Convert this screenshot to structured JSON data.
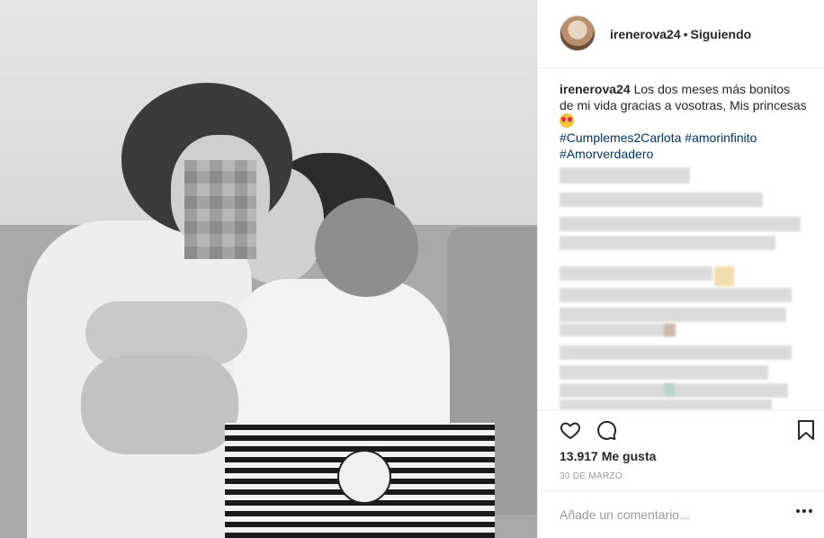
{
  "post": {
    "image_alt": "",
    "username": "irenerova24",
    "separator": "•",
    "follow_status": "Siguiendo",
    "caption_text": "Los dos meses más bonitos de mi vida gracias a vosotras, Mis princesas",
    "caption_emoji": "smiling-face-with-heart-eyes",
    "hashtags": [
      "#Cumplemes2Carlota",
      "#amorinfinito",
      "#Amorverdadero"
    ],
    "likes": "13.917 Me gusta",
    "date": "30 DE MARZO",
    "comment_placeholder": "Añade un comentario..."
  },
  "icons": {
    "like": "heart-icon",
    "comment": "comment-bubble-icon",
    "save": "bookmark-icon",
    "more": "more-options-icon"
  },
  "colors": {
    "text": "#262626",
    "hashtag": "#003569",
    "muted": "#999999",
    "divider": "#efefef"
  }
}
